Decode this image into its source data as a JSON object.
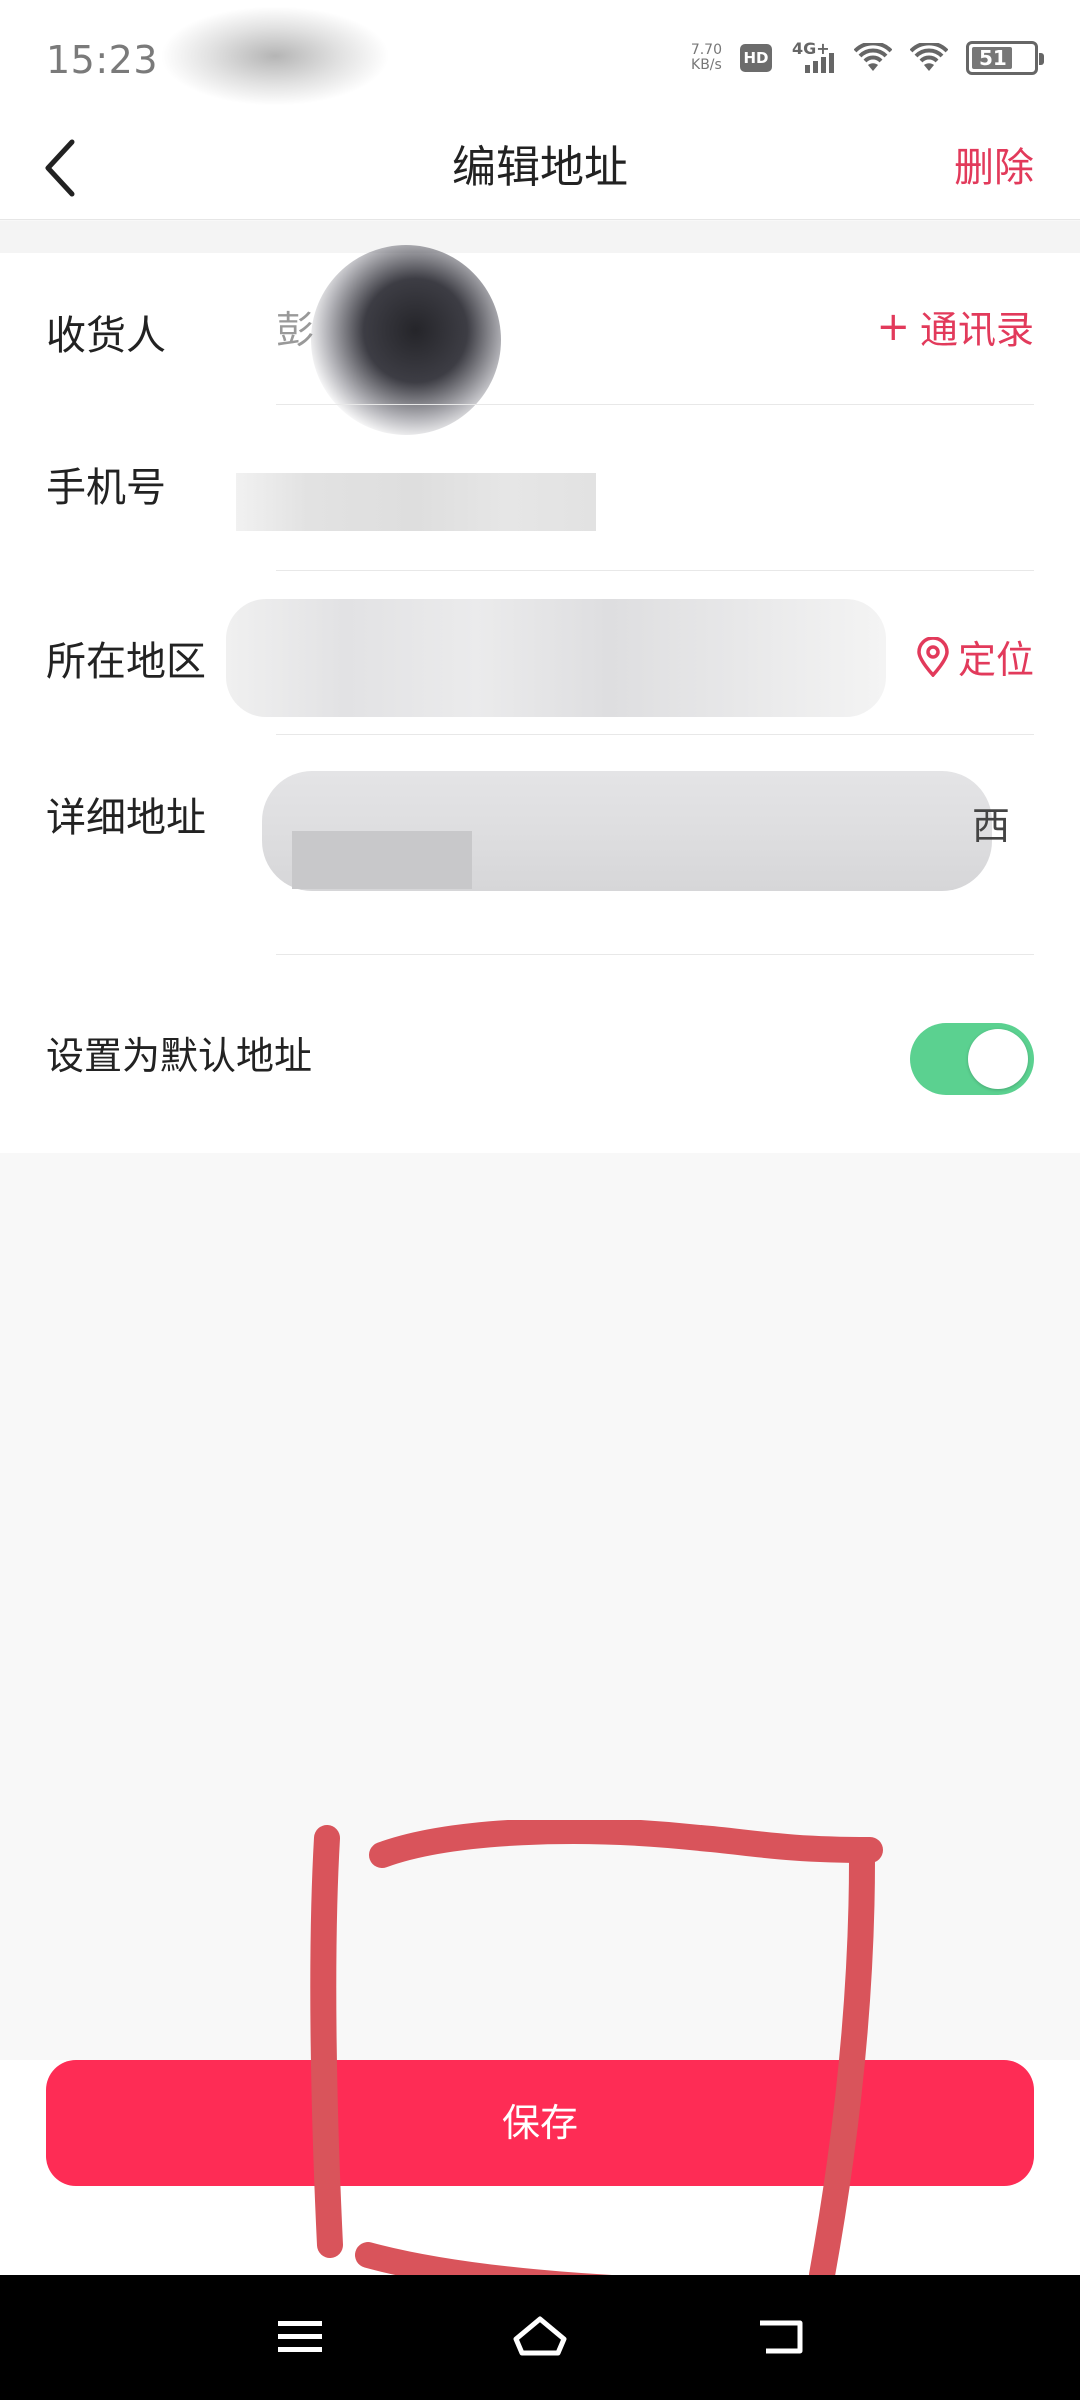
{
  "status_bar": {
    "time": "15:23",
    "net_speed_value": "7.70",
    "net_speed_unit": "KB/s",
    "hd_label": "HD",
    "network_label": "4G+",
    "battery_level": "51"
  },
  "header": {
    "title": "编辑地址",
    "delete_label": "删除"
  },
  "form": {
    "recipient": {
      "label": "收货人",
      "value": "彭",
      "contacts_label": "通讯录"
    },
    "phone": {
      "label": "手机号"
    },
    "region": {
      "label": "所在地区",
      "locate_label": "定位"
    },
    "address": {
      "label": "详细地址",
      "tail_char": "西"
    },
    "default": {
      "label": "设置为默认地址",
      "enabled": true
    }
  },
  "save": {
    "label": "保存"
  },
  "colors": {
    "accent": "#e23a5b",
    "primary_button": "#fe2c55",
    "toggle_on": "#5bd190",
    "annotation": "#d9545b"
  },
  "icons": [
    "back-chevron-icon",
    "plus-icon",
    "location-pin-icon",
    "menu-icon",
    "home-icon",
    "back-icon",
    "wifi-icon",
    "signal-icon",
    "battery-icon"
  ]
}
